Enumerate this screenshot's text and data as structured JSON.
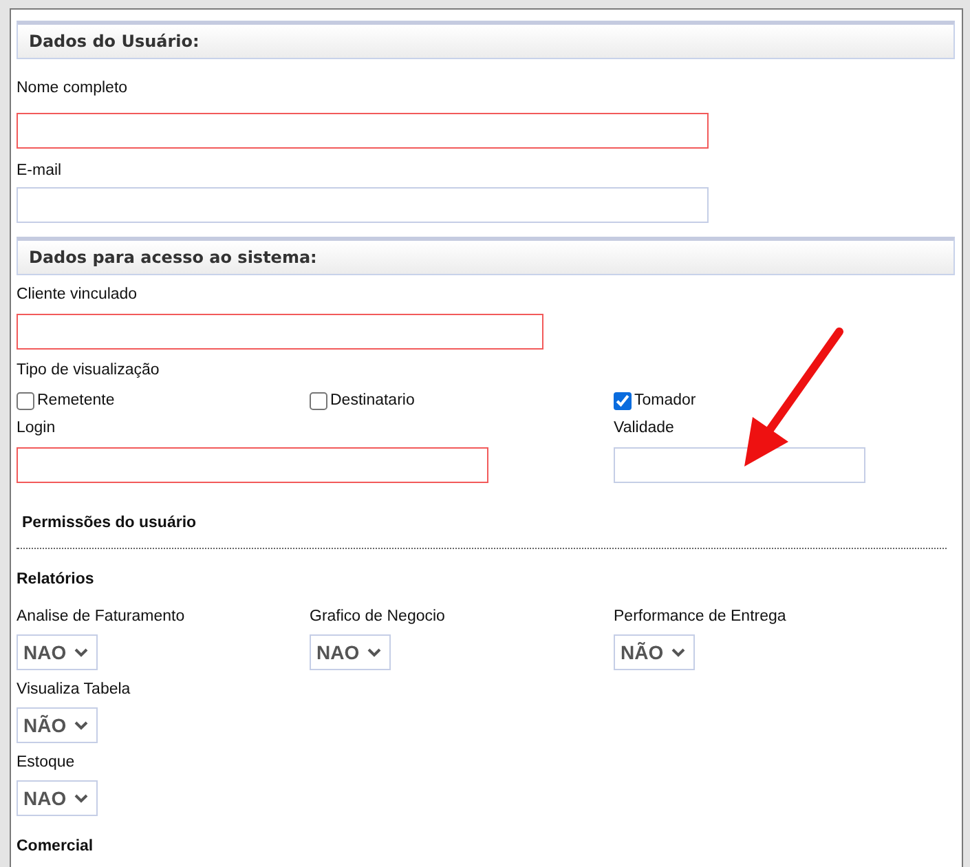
{
  "user_section": {
    "title": "Dados do Usuário:",
    "fields": [
      {
        "label": "Nome completo",
        "required": true
      },
      {
        "label": "E-mail",
        "required": false
      }
    ]
  },
  "access_section": {
    "title": "Dados para acesso ao sistema:",
    "client_field": {
      "label": "Cliente vinculado",
      "required": true
    },
    "view_type": {
      "label": "Tipo de visualização",
      "options": [
        {
          "label": "Remetente",
          "checked": false
        },
        {
          "label": "Destinatario",
          "checked": false
        },
        {
          "label": "Tomador",
          "checked": true
        }
      ]
    },
    "login_field": {
      "label": "Login",
      "required": true
    },
    "validity_field": {
      "label": "Validade",
      "required": false
    }
  },
  "permissions": {
    "title": "Permissões do usuário",
    "groups": [
      {
        "title": "Relatórios",
        "items": [
          {
            "label": "Analise de Faturamento",
            "value": "NAO"
          },
          {
            "label": "Grafico de Negocio",
            "value": "NAO"
          },
          {
            "label": "Performance de Entrega",
            "value": "NÃO"
          },
          {
            "label": "Visualiza Tabela",
            "value": "NÃO"
          },
          {
            "label": "Estoque",
            "value": "NAO"
          }
        ]
      },
      {
        "title": "Comercial"
      }
    ]
  }
}
